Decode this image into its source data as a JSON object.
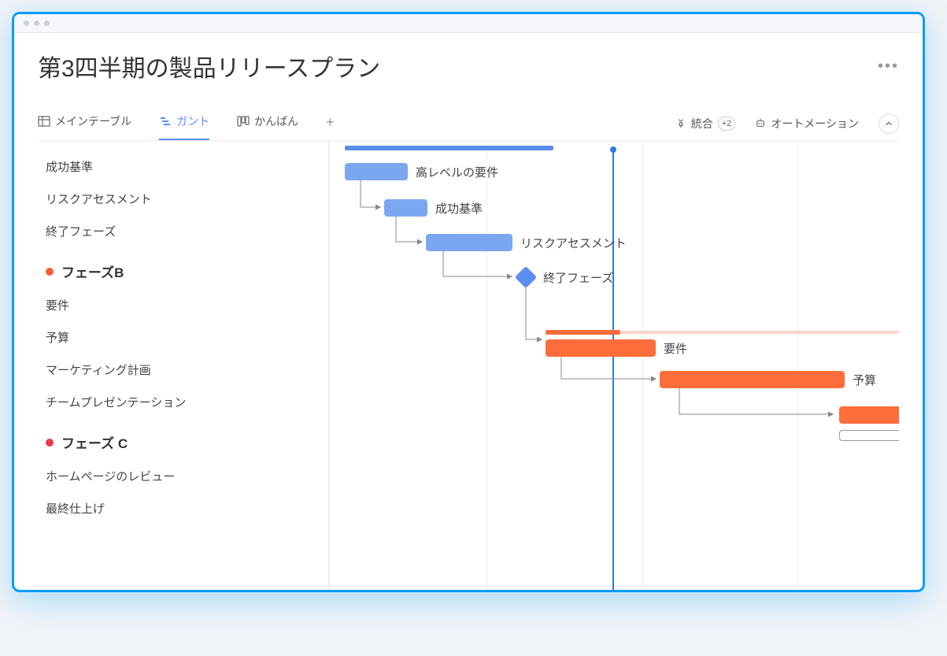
{
  "pageTitle": "第3四半期の製品リリースプラン",
  "tabs": {
    "mainTable": "メインテーブル",
    "gantt": "ガント",
    "kanban": "かんばん"
  },
  "toolbar": {
    "integrate": "統合",
    "integrateBadge": "+2",
    "automation": "オートメーション"
  },
  "sidebar": {
    "phaseA": {
      "tasks": [
        "成功基準",
        "リスクアセスメント",
        "終了フェーズ"
      ]
    },
    "phaseB": {
      "title": "フェーズB",
      "tasks": [
        "要件",
        "予算",
        "マーケティング計画",
        "チームプレゼンテーション"
      ]
    },
    "phaseC": {
      "title": "フェーズ C",
      "tasks": [
        "ホームページのレビュー",
        "最終仕上げ"
      ]
    }
  },
  "gantt": {
    "bars": {
      "highLevel": "高レベルの要件",
      "success": "成功基準",
      "risk": "リスクアセスメント",
      "endPhase": "終了フェーズ",
      "requirements": "要件",
      "budget": "予算"
    }
  },
  "colors": {
    "blue": "#5b8def",
    "orange": "#ff6d3a",
    "red": "#e8384f"
  }
}
